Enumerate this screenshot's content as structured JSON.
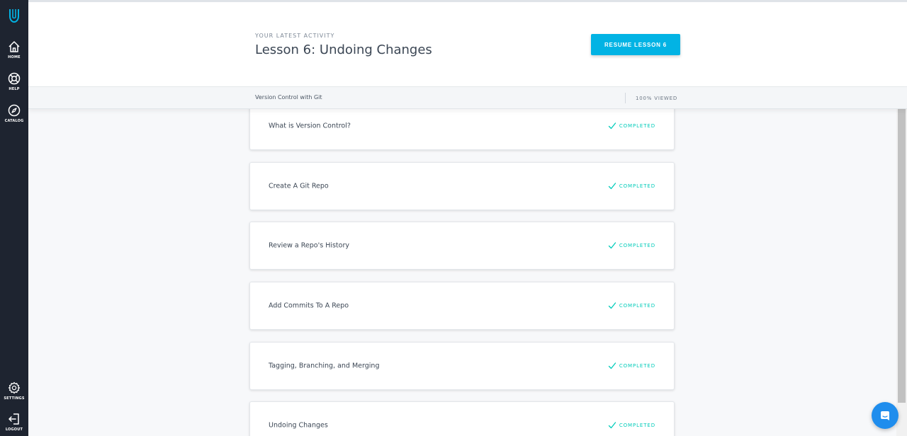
{
  "colors": {
    "sidebar_bg": "#1e2430",
    "accent": "#02b3e4",
    "completed": "#02ccba",
    "chat": "#1f8ded"
  },
  "sidebar": {
    "logo_icon": "udacity-logo-icon",
    "items": [
      {
        "label": "HOME",
        "icon": "home-icon"
      },
      {
        "label": "HELP",
        "icon": "lifebuoy-icon"
      },
      {
        "label": "CATALOG",
        "icon": "compass-icon"
      }
    ],
    "bottom_items": [
      {
        "label": "SETTINGS",
        "icon": "gear-icon"
      },
      {
        "label": "LOGOUT",
        "icon": "logout-icon"
      }
    ]
  },
  "header": {
    "eyebrow": "YOUR LATEST ACTIVITY",
    "title": "Lesson 6: Undoing Changes",
    "resume_label": "RESUME LESSON 6"
  },
  "subheader": {
    "course_name": "Version Control with Git",
    "viewed": "100% VIEWED"
  },
  "lessons": [
    {
      "title": "What is Version Control?",
      "status": "COMPLETED"
    },
    {
      "title": "Create A Git Repo",
      "status": "COMPLETED"
    },
    {
      "title": "Review a Repo's History",
      "status": "COMPLETED"
    },
    {
      "title": "Add Commits To A Repo",
      "status": "COMPLETED"
    },
    {
      "title": "Tagging, Branching, and Merging",
      "status": "COMPLETED"
    },
    {
      "title": "Undoing Changes",
      "status": "COMPLETED"
    }
  ],
  "chat": {
    "icon": "chat-icon"
  }
}
